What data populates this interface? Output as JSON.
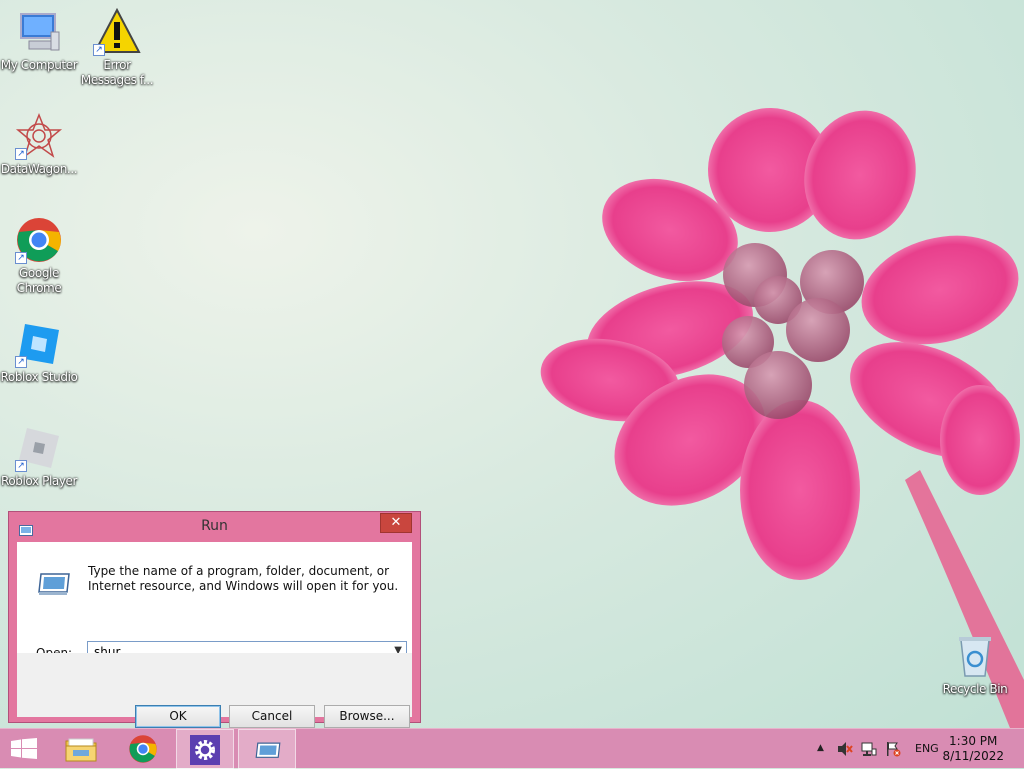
{
  "desktop": {
    "icons": [
      {
        "name": "my-computer-icon",
        "label": "My Computer"
      },
      {
        "name": "error-messages-icon",
        "label": "Error Messages f..."
      },
      {
        "name": "datawagon-icon",
        "label": "DataWagon..."
      },
      {
        "name": "google-chrome-icon",
        "label": "Google Chrome"
      },
      {
        "name": "roblox-studio-icon",
        "label": "Roblox Studio"
      },
      {
        "name": "roblox-player-icon",
        "label": "Roblox Player"
      },
      {
        "name": "recycle-bin-icon",
        "label": "Recycle Bin"
      }
    ]
  },
  "run_dialog": {
    "title": "Run",
    "close_glyph": "✕",
    "description": "Type the name of a program, folder, document, or Internet resource, and Windows will open it for you.",
    "open_label": "Open:",
    "open_value": "shur",
    "ok_label": "OK",
    "cancel_label": "Cancel",
    "browse_label": "Browse..."
  },
  "taskbar": {
    "items": [
      "start-button",
      "file-explorer",
      "google-chrome",
      "settings",
      "run"
    ],
    "language": "ENG",
    "time": "1:30 PM",
    "date": "8/11/2022"
  },
  "colors": {
    "dialog_frame": "#e3769f",
    "close_button": "#c9463e",
    "taskbar": "#d98cb3"
  }
}
